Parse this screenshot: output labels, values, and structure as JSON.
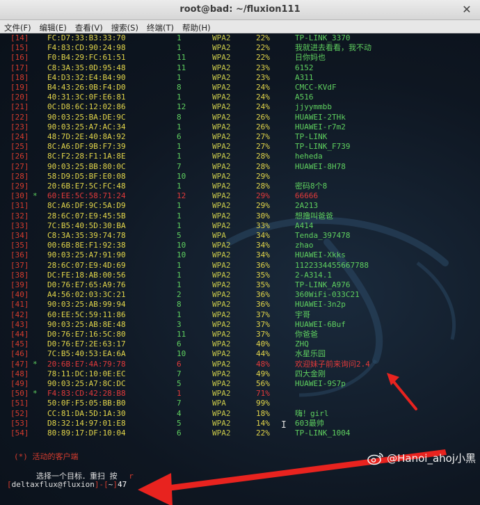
{
  "window": {
    "title": "root@bad: ~/fluxion111",
    "close_glyph": "✕"
  },
  "menu": [
    {
      "label": "文件(F)"
    },
    {
      "label": "编辑(E)"
    },
    {
      "label": "查看(V)"
    },
    {
      "label": "搜索(S)"
    },
    {
      "label": "终端(T)"
    },
    {
      "label": "帮助(H)"
    }
  ],
  "networks": [
    {
      "idx": "[14]",
      "mark": "",
      "mac": "FC:D7:33:B3:33:70",
      "ch": "1",
      "enc": "WPA2",
      "pwr": "22%",
      "essid": "TP-LINK_3370",
      "state": ""
    },
    {
      "idx": "[15]",
      "mark": "",
      "mac": "F4:83:CD:90:24:98",
      "ch": "1",
      "enc": "WPA2",
      "pwr": "22%",
      "essid": "我就进去看看，我不动",
      "state": ""
    },
    {
      "idx": "[16]",
      "mark": "",
      "mac": "F0:B4:29:FC:61:51",
      "ch": "11",
      "enc": "WPA2",
      "pwr": "22%",
      "essid": "日你妈也",
      "state": ""
    },
    {
      "idx": "[17]",
      "mark": "",
      "mac": "C8:3A:35:0D:95:48",
      "ch": "11",
      "enc": "WPA2",
      "pwr": "23%",
      "essid": "6152",
      "state": ""
    },
    {
      "idx": "[18]",
      "mark": "",
      "mac": "E4:D3:32:E4:B4:90",
      "ch": "1",
      "enc": "WPA2",
      "pwr": "23%",
      "essid": "A311",
      "state": ""
    },
    {
      "idx": "[19]",
      "mark": "",
      "mac": "B4:43:26:0B:F4:D0",
      "ch": "8",
      "enc": "WPA2",
      "pwr": "24%",
      "essid": "CMCC-KVdF",
      "state": ""
    },
    {
      "idx": "[20]",
      "mark": "",
      "mac": "40:31:3C:0F:E6:81",
      "ch": "1",
      "enc": "WPA2",
      "pwr": "24%",
      "essid": "A516",
      "state": ""
    },
    {
      "idx": "[21]",
      "mark": "",
      "mac": "0C:D8:6C:12:02:86",
      "ch": "12",
      "enc": "WPA2",
      "pwr": "24%",
      "essid": "jjyymmbb",
      "state": ""
    },
    {
      "idx": "[22]",
      "mark": "",
      "mac": "90:03:25:BA:DE:9C",
      "ch": "8",
      "enc": "WPA2",
      "pwr": "26%",
      "essid": "HUAWEI-2THk",
      "state": ""
    },
    {
      "idx": "[23]",
      "mark": "",
      "mac": "90:03:25:A7:AC:34",
      "ch": "1",
      "enc": "WPA2",
      "pwr": "26%",
      "essid": "HUAWEI-r7m2",
      "state": ""
    },
    {
      "idx": "[24]",
      "mark": "",
      "mac": "48:7D:2E:40:8A:92",
      "ch": "6",
      "enc": "WPA2",
      "pwr": "27%",
      "essid": "TP-LINK",
      "state": ""
    },
    {
      "idx": "[25]",
      "mark": "",
      "mac": "8C:A6:DF:9B:F7:39",
      "ch": "1",
      "enc": "WPA2",
      "pwr": "27%",
      "essid": "TP-LINK_F739",
      "state": ""
    },
    {
      "idx": "[26]",
      "mark": "",
      "mac": "8C:F2:28:F1:1A:8E",
      "ch": "1",
      "enc": "WPA2",
      "pwr": "28%",
      "essid": "heheda",
      "state": ""
    },
    {
      "idx": "[27]",
      "mark": "",
      "mac": "90:03:25:BB:80:0C",
      "ch": "7",
      "enc": "WPA2",
      "pwr": "28%",
      "essid": "HUAWEI-8H78",
      "state": ""
    },
    {
      "idx": "[28]",
      "mark": "",
      "mac": "58:D9:D5:BF:E0:08",
      "ch": "10",
      "enc": "WPA2",
      "pwr": "29%",
      "essid": "",
      "state": ""
    },
    {
      "idx": "[29]",
      "mark": "",
      "mac": "20:6B:E7:5C:FC:48",
      "ch": "1",
      "enc": "WPA2",
      "pwr": "28%",
      "essid": "密码8个8",
      "state": ""
    },
    {
      "idx": "[30]",
      "mark": "*",
      "mac": "60:EE:5C:58:71:24",
      "ch": "12",
      "enc": "WPA2",
      "pwr": "29%",
      "essid": "66666",
      "state": "active"
    },
    {
      "idx": "[31]",
      "mark": "",
      "mac": "8C:A6:DF:9C:5A:D9",
      "ch": "1",
      "enc": "WPA2",
      "pwr": "29%",
      "essid": "2A213",
      "state": ""
    },
    {
      "idx": "[32]",
      "mark": "",
      "mac": "28:6C:07:E9:45:5B",
      "ch": "1",
      "enc": "WPA2",
      "pwr": "30%",
      "essid": "想撸叫爸爸",
      "state": ""
    },
    {
      "idx": "[33]",
      "mark": "",
      "mac": "7C:B5:40:5D:30:BA",
      "ch": "1",
      "enc": "WPA2",
      "pwr": "33%",
      "essid": "A414",
      "state": ""
    },
    {
      "idx": "[34]",
      "mark": "",
      "mac": "C8:3A:35:39:74:78",
      "ch": "5",
      "enc": "WPA",
      "pwr": "34%",
      "essid": "Tenda_397478",
      "state": ""
    },
    {
      "idx": "[35]",
      "mark": "",
      "mac": "00:6B:8E:F1:92:38",
      "ch": "10",
      "enc": "WPA2",
      "pwr": "34%",
      "essid": "zhao",
      "state": ""
    },
    {
      "idx": "[36]",
      "mark": "",
      "mac": "90:03:25:A7:91:90",
      "ch": "10",
      "enc": "WPA2",
      "pwr": "34%",
      "essid": "HUAWEI-Xkks",
      "state": ""
    },
    {
      "idx": "[37]",
      "mark": "",
      "mac": "28:6C:07:E9:4D:69",
      "ch": "1",
      "enc": "WPA2",
      "pwr": "36%",
      "essid": "1122334455667788",
      "state": ""
    },
    {
      "idx": "[38]",
      "mark": "",
      "mac": "DC:FE:18:AB:00:56",
      "ch": "1",
      "enc": "WPA2",
      "pwr": "35%",
      "essid": "2-A314.1",
      "state": ""
    },
    {
      "idx": "[39]",
      "mark": "",
      "mac": "D0:76:E7:65:A9:76",
      "ch": "1",
      "enc": "WPA2",
      "pwr": "35%",
      "essid": "TP-LINK_A976",
      "state": ""
    },
    {
      "idx": "[40]",
      "mark": "",
      "mac": "A4:56:02:03:3C:21",
      "ch": "2",
      "enc": "WPA2",
      "pwr": "36%",
      "essid": "360WiFi-033C21",
      "state": ""
    },
    {
      "idx": "[41]",
      "mark": "",
      "mac": "90:03:25:AB:99:94",
      "ch": "8",
      "enc": "WPA2",
      "pwr": "36%",
      "essid": "HUAWEI-3n2p",
      "state": ""
    },
    {
      "idx": "[42]",
      "mark": "",
      "mac": "60:EE:5C:59:11:86",
      "ch": "1",
      "enc": "WPA2",
      "pwr": "37%",
      "essid": "宇哥",
      "state": ""
    },
    {
      "idx": "[43]",
      "mark": "",
      "mac": "90:03:25:AB:8E:48",
      "ch": "3",
      "enc": "WPA2",
      "pwr": "37%",
      "essid": "HUAWEI-6Buf",
      "state": ""
    },
    {
      "idx": "[44]",
      "mark": "",
      "mac": "D0:76:E7:16:5C:80",
      "ch": "11",
      "enc": "WPA2",
      "pwr": "37%",
      "essid": "你爸爸",
      "state": ""
    },
    {
      "idx": "[45]",
      "mark": "",
      "mac": "D0:76:E7:2E:63:17",
      "ch": "6",
      "enc": "WPA2",
      "pwr": "40%",
      "essid": "ZHQ",
      "state": ""
    },
    {
      "idx": "[46]",
      "mark": "",
      "mac": "7C:B5:40:53:EA:6A",
      "ch": "10",
      "enc": "WPA2",
      "pwr": "44%",
      "essid": "水星乐园",
      "state": ""
    },
    {
      "idx": "[47]",
      "mark": "*",
      "mac": "20:6B:E7:4A:79:78",
      "ch": "6",
      "enc": "WPA2",
      "pwr": "48%",
      "essid": "欢迎妹子前来询问2.4",
      "state": "active"
    },
    {
      "idx": "[48]",
      "mark": "",
      "mac": "78:11:DC:10:0E:EC",
      "ch": "7",
      "enc": "WPA2",
      "pwr": "49%",
      "essid": "四大金刚",
      "state": ""
    },
    {
      "idx": "[49]",
      "mark": "",
      "mac": "90:03:25:A7:8C:DC",
      "ch": "5",
      "enc": "WPA2",
      "pwr": "56%",
      "essid": "HUAWEI-9S7p",
      "state": ""
    },
    {
      "idx": "[50]",
      "mark": "*",
      "mac": "F4:83:CD:42:28:B8",
      "ch": "1",
      "enc": "WPA2",
      "pwr": "71%",
      "essid": "",
      "state": "active50"
    },
    {
      "idx": "[51]",
      "mark": "",
      "mac": "50:0F:F5:05:BB:B0",
      "ch": "7",
      "enc": "WPA",
      "pwr": "99%",
      "essid": "",
      "state": ""
    },
    {
      "idx": "[52]",
      "mark": "",
      "mac": "CC:81:DA:5D:1A:30",
      "ch": "4",
      "enc": "WPA2",
      "pwr": "18%",
      "essid": "嗨！girl",
      "state": ""
    },
    {
      "idx": "[53]",
      "mark": "",
      "mac": "D8:32:14:97:01:E8",
      "ch": "5",
      "enc": "WPA2",
      "pwr": "14%",
      "essid": "603最帅",
      "state": ""
    },
    {
      "idx": "[54]",
      "mark": "",
      "mac": "80:89:17:DF:10:04",
      "ch": "6",
      "enc": "WPA2",
      "pwr": "22%",
      "essid": "TP-LINK_1004",
      "state": ""
    }
  ],
  "clients_label": "(*) 活动的客户端",
  "prompt": {
    "message": "选择一个目标．重扫 按",
    "rescan_key": "r",
    "open_bracket": "[",
    "user_host": "deltaxflux@fluxion",
    "mid": "]-[",
    "path": "~",
    "close_bracket": "]",
    "input_value": "47"
  },
  "cursor_glyph": "I",
  "watermark": {
    "text": "@Hanoi_ahoj小黑",
    "icon": "weibo-icon"
  },
  "colors": {
    "annotation_arrow": "#e8231f",
    "terminal_bg": "#0e1621",
    "index_red": "#d63c2e",
    "mac_yellow": "#e3d64a",
    "essid_green": "#5fd05f"
  }
}
